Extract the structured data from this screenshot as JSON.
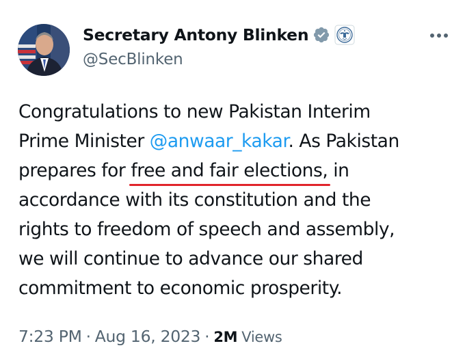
{
  "author": {
    "display_name": "Secretary Antony Blinken",
    "handle": "@SecBlinken",
    "avatar": "avatar-photo-icon",
    "verified_badge": "verified-badge-icon",
    "affiliation_badge": "state-department-seal-icon"
  },
  "menu": {
    "more_icon": "more-horizontal-icon"
  },
  "tweet": {
    "lines": [
      "Congratulations to new Pakistan Interim",
      "Prime Minister ",
      "@anwaar_kakar",
      ". As Pakistan",
      "prepares for ",
      "free and fair elections,",
      " in",
      "accordance with its constitution and the",
      "rights to freedom of speech and assembly,",
      "we will continue to advance our shared",
      "commitment to economic prosperity."
    ],
    "mention": "@anwaar_kakar",
    "highlighted_phrase": "free and fair elections,"
  },
  "meta": {
    "time": "7:23 PM",
    "separator": "·",
    "date": "Aug 16, 2023",
    "views_count": "2M",
    "views_label": "Views"
  },
  "colors": {
    "text": "#0f1419",
    "secondary": "#536471",
    "link": "#1d9bf0",
    "verified": "#829aab",
    "underline": "#e0242b"
  }
}
